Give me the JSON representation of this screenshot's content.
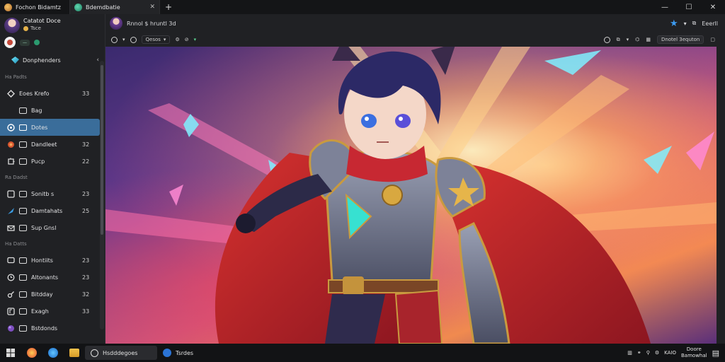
{
  "tabs": [
    {
      "label": "Fochon Bidamtz",
      "close": ""
    },
    {
      "label": "Bdemdbatie",
      "close": "✕"
    }
  ],
  "new_tab": "+",
  "window_controls": [
    "—",
    "☐",
    "✕"
  ],
  "profile": {
    "name": "Catatot Doce",
    "status": "Tsce",
    "badge": "—"
  },
  "spaces": {
    "label": "Donphenders",
    "chevron": "‹"
  },
  "sidebar": {
    "sections": [
      {
        "title": "Ha Padts",
        "items": [
          {
            "label": "Eoes Krefo",
            "count": "33",
            "icon": "diamond-icon"
          },
          {
            "label": "Bag",
            "count": "",
            "icon": "folder-icon",
            "sub": true
          },
          {
            "label": "Dotes",
            "count": "",
            "icon": "phone-icon",
            "active": true
          },
          {
            "label": "Dandleet",
            "count": "32",
            "icon": "flame-icon"
          },
          {
            "label": "Pucp",
            "count": "22",
            "icon": "puzzle-icon"
          }
        ]
      },
      {
        "title": "Ra Dadst",
        "items": [
          {
            "label": "Sonitb s",
            "count": "23",
            "icon": "square-icon"
          },
          {
            "label": "Damtahats",
            "count": "25",
            "icon": "feather-icon"
          },
          {
            "label": "Sup Gnsl",
            "count": "",
            "icon": "mail-icon"
          }
        ]
      },
      {
        "title": "Ha Datts",
        "items": [
          {
            "label": "Hontiits",
            "count": "23",
            "icon": "chat-icon"
          },
          {
            "label": "Altonants",
            "count": "23",
            "icon": "clock-icon"
          },
          {
            "label": "Bitdday",
            "count": "32",
            "icon": "link-icon"
          },
          {
            "label": "Exagh",
            "count": "33",
            "icon": "music-icon"
          },
          {
            "label": "Bstdonds",
            "count": "",
            "icon": "planet-icon"
          }
        ]
      }
    ]
  },
  "header": {
    "title": "Rnnol $ hruntl 3d",
    "right_label": "Eeerll"
  },
  "toolbar": {
    "dropdown": "Qesos",
    "zoom": "Dnotel 3equton"
  },
  "taskbar": {
    "apps": [
      {
        "label": "Hsdddegoes"
      },
      {
        "label": "Tsrdes"
      }
    ],
    "tray_label": "KAIO",
    "clock_top": "Doore",
    "clock_bottom": "Bamowhal"
  },
  "colors": {
    "accent": "#3a6d9a",
    "star": "#3d9bf0"
  }
}
